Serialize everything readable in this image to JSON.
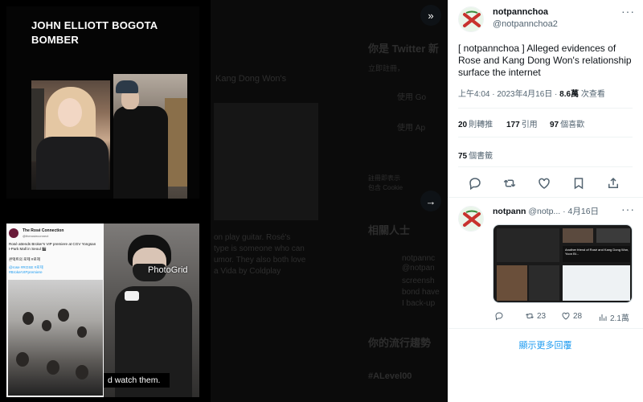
{
  "media": {
    "image1_title": "JOHN ELLIOTT BOGOTA BOMBER",
    "image2_account": "The Rosé Connection",
    "image2_handle": "@therosieconnect",
    "image2_text": "Rosé attends Broker's VIP premiere at CGV Yongsan I-Park Mall in Seoul 🎬",
    "image2_korean": "콘택트의 로제 #로제",
    "image2_tags": "@rose #ROSE #로제",
    "image2_tag2": "#BrokerVIPpremiere",
    "image2_watermark": "PhotoGrid",
    "image2_caption": "d watch them."
  },
  "background_page": {
    "items": [
      "你是 Twitter 新",
      "立即註冊，",
      "使用 Go",
      "使用 Ap",
      "Kang Dong Won's",
      "註冊即表示",
      "包含 Cookie",
      "on play guitar. Rosé's",
      "type is someone who can",
      "umor. They also both love",
      "a Vida by Coldplay",
      "相關人士",
      "notpannc",
      "@notpan",
      "screensh",
      "bond have",
      "I back-up",
      "你的流行趨勢",
      "#ALevel00"
    ]
  },
  "controls": {
    "expand_icon": "»",
    "next_icon": "→"
  },
  "tweet": {
    "name": "notpannchoa",
    "handle": "@notpannchoa2",
    "text": "[ notpannchoa ] Alleged evidences of Rose and Kang Dong Won's relationship surface the internet",
    "time": "上午4:04 · 2023年4月16日 · ",
    "views_count": "8.6萬",
    "views_label": " 次查看",
    "retweets_count": "20",
    "retweets_label": "則轉推",
    "quotes_count": "177",
    "quotes_label": "引用",
    "likes_count": "97",
    "likes_label": "個喜歡",
    "bookmarks_count": "75",
    "bookmarks_label": "個書籤",
    "more": "···"
  },
  "reply": {
    "name": "notpann",
    "handle": "@notp...",
    "date": "· 4月16日",
    "more": "···",
    "thumb_caption_1": "Another friend of Rosé and Kang Dong Won, Yoon Bi...",
    "retweets": "23",
    "likes": "28",
    "views": "2.1萬"
  },
  "show_more_replies": "顯示更多回覆",
  "colors": {
    "accent": "#1d9bf0",
    "text": "#0f1419",
    "secondary": "#536471",
    "avatar_x": "#c8322e",
    "avatar_bg": "#eaf5ea"
  }
}
